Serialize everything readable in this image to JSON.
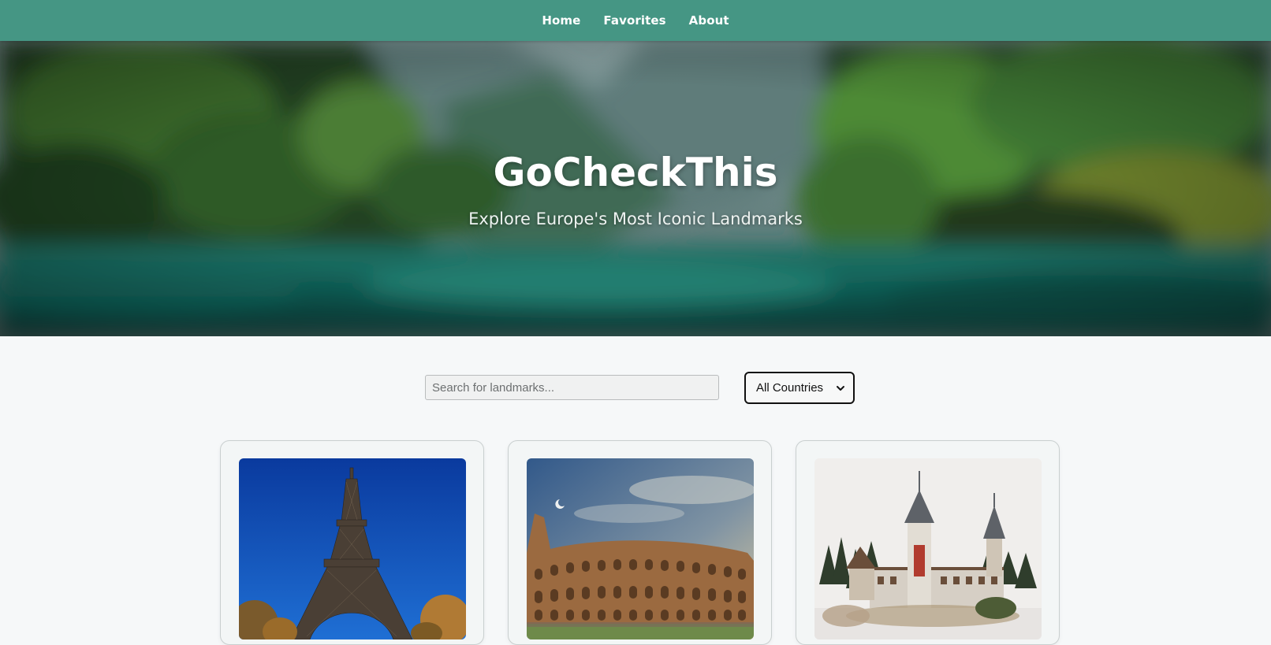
{
  "nav": {
    "items": [
      "Home",
      "Favorites",
      "About"
    ]
  },
  "hero": {
    "title": "GoCheckThis",
    "subtitle": "Explore Europe's Most Iconic Landmarks"
  },
  "search": {
    "placeholder": "Search for landmarks...",
    "value": ""
  },
  "filter": {
    "selected": "All Countries"
  },
  "cards": [
    {
      "image": "eiffel-tower-photo"
    },
    {
      "image": "colosseum-photo"
    },
    {
      "image": "peles-castle-photo"
    }
  ],
  "colors": {
    "nav": "#459684",
    "page_bg": "#f6f8f9"
  }
}
